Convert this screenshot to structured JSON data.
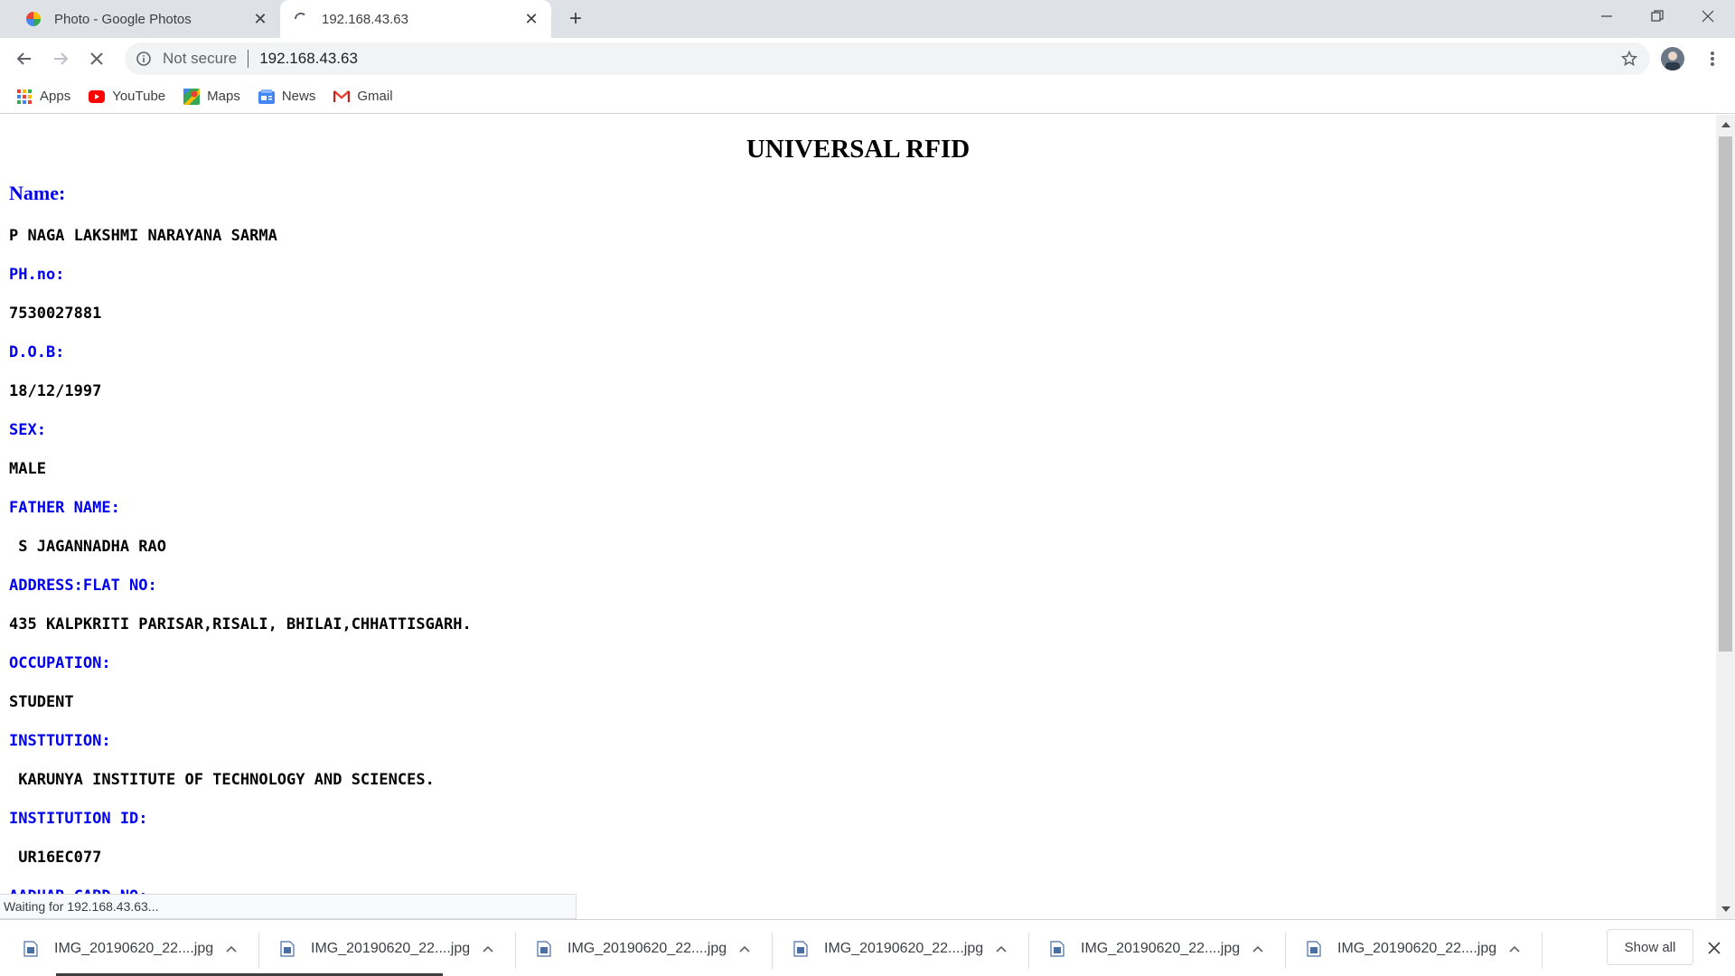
{
  "browser": {
    "tabs": [
      {
        "title": "Photo - Google Photos",
        "favicon": "google-photos-icon",
        "active": false
      },
      {
        "title": "192.168.43.63",
        "favicon": "loading-spinner-icon",
        "active": true
      }
    ],
    "omnibox": {
      "security_text": "Not secure",
      "url": "192.168.43.63"
    },
    "bookmarks": [
      {
        "label": "Apps",
        "icon": "apps-grid-icon"
      },
      {
        "label": "YouTube",
        "icon": "youtube-icon"
      },
      {
        "label": "Maps",
        "icon": "maps-icon"
      },
      {
        "label": "News",
        "icon": "news-icon"
      },
      {
        "label": "Gmail",
        "icon": "gmail-icon"
      }
    ],
    "status_text": "Waiting for 192.168.43.63..."
  },
  "page": {
    "title": "UNIVERSAL RFID",
    "name_label": "Name:",
    "name_value": "P NAGA LAKSHMI NARAYANA SARMA",
    "fields": [
      {
        "label": "PH.no:",
        "value": "7530027881"
      },
      {
        "label": "D.O.B:",
        "value": "18/12/1997"
      },
      {
        "label": "SEX:",
        "value": "MALE"
      },
      {
        "label": "FATHER NAME:",
        "value": " S JAGANNADHA RAO"
      },
      {
        "label": "ADDRESS:FLAT NO:",
        "value": "435 KALPKRITI PARISAR,RISALI, BHILAI,CHHATTISGARH."
      },
      {
        "label": "OCCUPATION:",
        "value": "STUDENT"
      },
      {
        "label": "INSTTUTION:",
        "value": " KARUNYA INSTITUTE OF TECHNOLOGY AND SCIENCES."
      },
      {
        "label": "INSTITUTION ID:",
        "value": " UR16EC077"
      },
      {
        "label": "AADHAR CARD NO:"
      }
    ],
    "label_color": "#0000ee",
    "value_color": "#000000"
  },
  "downloads": {
    "items": [
      {
        "filename": "IMG_20190620_22....jpg"
      },
      {
        "filename": "IMG_20190620_22....jpg"
      },
      {
        "filename": "IMG_20190620_22....jpg"
      },
      {
        "filename": "IMG_20190620_22....jpg"
      },
      {
        "filename": "IMG_20190620_22....jpg"
      },
      {
        "filename": "IMG_20190620_22....jpg"
      }
    ],
    "show_all_label": "Show all"
  }
}
